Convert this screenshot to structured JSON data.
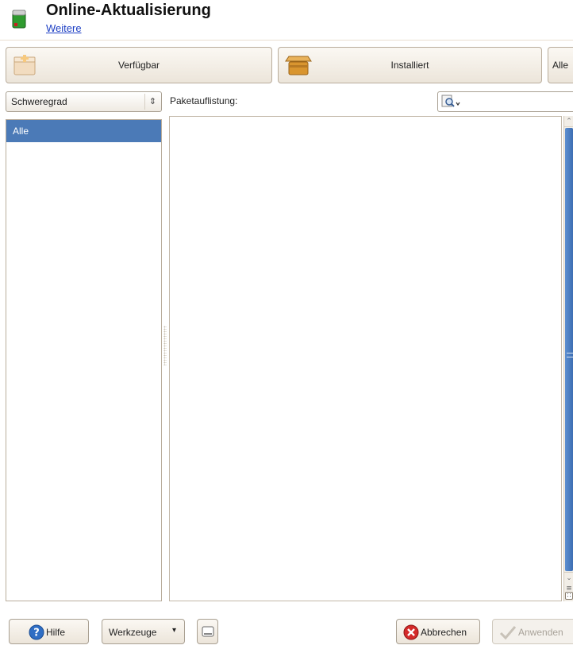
{
  "header": {
    "title": "Online-Aktualisierung",
    "link": "Weitere"
  },
  "top_buttons": {
    "verfuegbar": "Verfügbar",
    "installiert": "Installiert",
    "alle": "Alle"
  },
  "filter": {
    "combo_value": "Schweregrad",
    "items": [
      {
        "label": "Alle",
        "selected": true
      }
    ]
  },
  "package_list": {
    "label": "Paketauflistung:",
    "search_value": ""
  },
  "bottom_buttons": {
    "hilfe": "Hilfe",
    "werkzeuge": "Werkzeuge",
    "abbrechen": "Abbrechen",
    "anwenden": "Anwenden"
  },
  "colors": {
    "selection": "#4b7ab7",
    "link": "#1d3fc4",
    "scroll_thumb": "#3d6eb3"
  }
}
